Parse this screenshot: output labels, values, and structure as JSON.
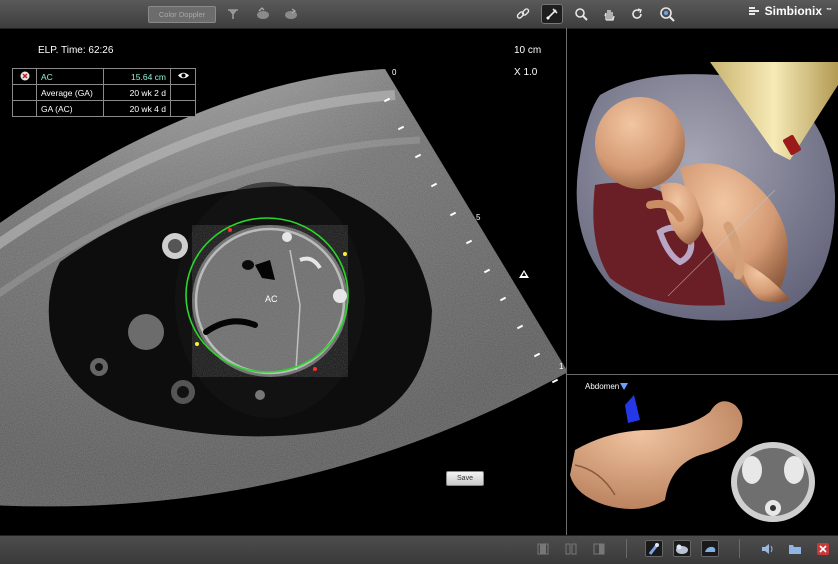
{
  "toolbar": {
    "color_doppler_label": "Color Doppler",
    "logo_text": "Simbionix",
    "logo_tm": "™"
  },
  "ultrasound": {
    "elapsed_time": "ELP. Time: 62:26",
    "depth": "10 cm",
    "zoom": "X 1.0",
    "scale_labels": [
      "0",
      "5",
      "1"
    ],
    "circle_label": "AC",
    "save_label": "Save",
    "measurements": [
      {
        "name": "AC",
        "value": "15.64 cm",
        "selected": true
      },
      {
        "name": "Average (GA)",
        "value": "20 wk 2 d",
        "selected": false
      },
      {
        "name": "GA (AC)",
        "value": "20 wk 4 d",
        "selected": false
      }
    ]
  },
  "body_view": {
    "probe_location": "Abdomen"
  },
  "colors": {
    "accent_measure": "#8ff0d9",
    "caliper_circle": "#2bd62b",
    "probe_marker": "#2438e8",
    "fetus_skin": "#d9a07c",
    "placenta": "#6a1f26"
  }
}
